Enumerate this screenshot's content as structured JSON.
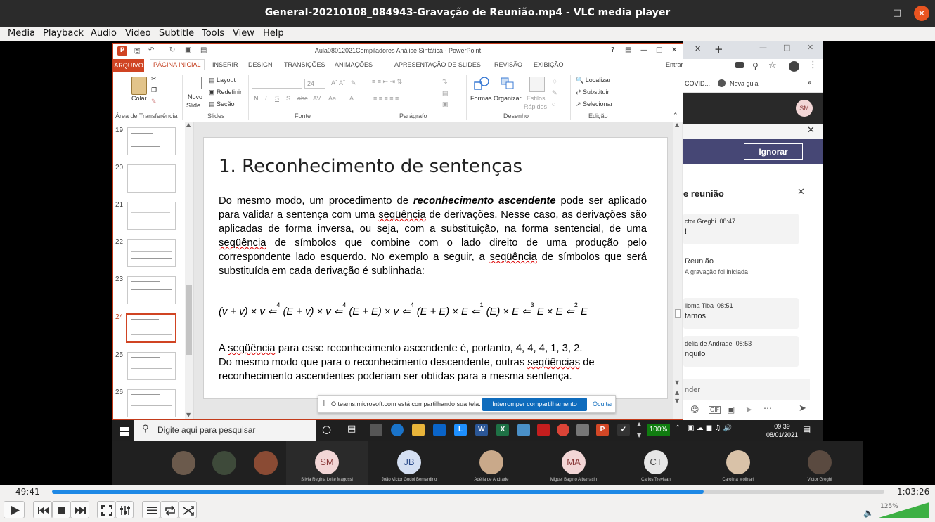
{
  "vlc": {
    "window_title": "General-20210108_084943-Gravação de Reunião.mp4 - VLC media player",
    "menu": [
      "Media",
      "Playback",
      "Audio",
      "Video",
      "Subtitle",
      "Tools",
      "View",
      "Help"
    ],
    "time_elapsed": "49:41",
    "time_total": "1:03:26",
    "progress": 0.783,
    "volume_label": "125%",
    "volume_level": 1.0
  },
  "ppt": {
    "title": "Aula08012021Compiladores Análise Sintática - PowerPoint",
    "sign_in": "Entrar",
    "tabs": [
      "ARQUIVO",
      "PÁGINA INICIAL",
      "INSERIR",
      "DESIGN",
      "TRANSIÇÕES",
      "ANIMAÇÕES",
      "APRESENTAÇÃO DE SLIDES",
      "REVISÃO",
      "EXIBIÇÃO"
    ],
    "ribbon": {
      "paste": "Colar",
      "new_slide_1": "Novo",
      "new_slide_2": "Slide",
      "layout": "Layout",
      "reset": "Redefinir",
      "section": "Seção",
      "font_size": "24",
      "shapes": "Formas",
      "arrange": "Organizar",
      "quick_styles_1": "Estilos",
      "quick_styles_2": "Rápidos",
      "find": "Localizar",
      "replace": "Substituir",
      "select": "Selecionar",
      "groups": [
        "Área de Transferência",
        "Slides",
        "Fonte",
        "Parágrafo",
        "Desenho",
        "Edição"
      ]
    },
    "thumbnails": [
      "19",
      "20",
      "21",
      "22",
      "23",
      "24",
      "25",
      "26"
    ],
    "selected_thumbnail": "24",
    "slide": {
      "title": "1. Reconhecimento de sentenças",
      "p1_a": "Do mesmo modo, um procedimento de ",
      "p1_bold": "reconhecimento ascendente",
      "p1_b": " pode ser aplicado para validar a sentença com uma ",
      "p1_sq1": "seqüência",
      "p1_c": " de derivações. Nesse caso, as derivações são aplicadas de forma inversa, ou seja, com a substituição, na forma sentencial, de uma ",
      "p1_sq2": "seqüência",
      "p1_d": " de símbolos que combine com o lado direito de uma produção pelo correspondente lado esquerdo. No exemplo a seguir, a ",
      "p1_sq3": "seqüência",
      "p1_e": " de símbolos que será substituída em cada derivação é sublinhada:",
      "deriv": [
        {
          "expr": "(v + v) × v",
          "step": ""
        },
        {
          "expr": " (E + v) × v",
          "step": "4"
        },
        {
          "expr": " (E + E) × v",
          "step": "4"
        },
        {
          "expr": " (E + E) × E",
          "step": "4"
        },
        {
          "expr": " (E) × E",
          "step": "1"
        },
        {
          "expr": " E × E",
          "step": "3"
        },
        {
          "expr": " E",
          "step": "2"
        }
      ],
      "arrow": "⇐",
      "p2_a": "A ",
      "p2_sq1": "seqüência",
      "p2_b": " para esse reconhecimento ascendente é, portanto, 4, 4, 4, 1, 3, 2.",
      "p3_a": "Do mesmo modo que para o reconhecimento descendente, outras ",
      "p3_sq": "seqüências",
      "p3_b": " de reconhecimento ascendentes poderiam ser obtidas para a mesma sentença."
    },
    "share_banner": {
      "text": "O teams.microsoft.com está compartilhando sua tela.",
      "stop": "Interromper compartilhamento",
      "hide": "Ocultar"
    }
  },
  "teams": {
    "bookmark_1": "COVID...",
    "bookmark_2": "Nova guia",
    "avatar": "SM",
    "ignore": "Ignorar",
    "chat_title": "e reunião",
    "messages": [
      {
        "name": "ctor Greghi",
        "time": "08:47",
        "text": "!"
      },
      {
        "name": "Reunião",
        "time": "",
        "text": "A gravação foi iniciada"
      },
      {
        "name": "lloma Tiba",
        "time": "08:51",
        "text": "tamos"
      },
      {
        "name": "délia de Andrade",
        "time": "08:53",
        "text": "nquilo"
      }
    ],
    "input_placeholder": "nder"
  },
  "taskbar": {
    "search_placeholder": "Digite aqui para pesquisar",
    "zoom": "100%",
    "time": "09:39",
    "date": "08/01/2021"
  },
  "participants": [
    {
      "initials": "",
      "name": "",
      "color": "#6b5a4c"
    },
    {
      "initials": "",
      "name": "",
      "color": "#3e4a3a"
    },
    {
      "initials": "",
      "name": "",
      "color": "#8a4b34"
    },
    {
      "initials": "SM",
      "name": "Silvia Regina Leite Magossi",
      "color": "#f2d6d6"
    },
    {
      "initials": "JB",
      "name": "João Victor Godoi Bernardino",
      "color": "#d4dff2"
    },
    {
      "initials": "",
      "name": "Adélia de Andrade",
      "color": "#c9a98a"
    },
    {
      "initials": "MA",
      "name": "Miguel Bagino Albarracin",
      "color": "#f2d6d6"
    },
    {
      "initials": "CT",
      "name": "Carlos Trevisan",
      "color": "#e6e6e6"
    },
    {
      "initials": "",
      "name": "Carolina Molinari",
      "color": "#d9c2a8"
    },
    {
      "initials": "",
      "name": "Victor Greghi",
      "color": "#5a4a40"
    }
  ]
}
